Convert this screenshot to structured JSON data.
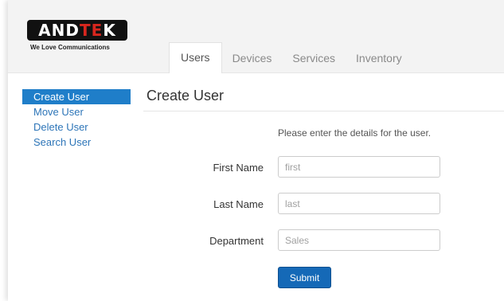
{
  "brand": {
    "name_part1": "AND",
    "name_part2": "TE",
    "name_part3": "K",
    "tagline": "We Love Communications"
  },
  "tabs": [
    {
      "label": "Users",
      "active": true
    },
    {
      "label": "Devices",
      "active": false
    },
    {
      "label": "Services",
      "active": false
    },
    {
      "label": "Inventory",
      "active": false
    }
  ],
  "sidebar": {
    "items": [
      {
        "label": "Create User",
        "active": true
      },
      {
        "label": "Move User",
        "active": false
      },
      {
        "label": "Delete User",
        "active": false
      },
      {
        "label": "Search User",
        "active": false
      }
    ]
  },
  "main": {
    "title": "Create User",
    "intro": "Please enter the details for the user.",
    "form": {
      "first_name": {
        "label": "First Name",
        "placeholder": "first",
        "value": ""
      },
      "last_name": {
        "label": "Last Name",
        "placeholder": "last",
        "value": ""
      },
      "department": {
        "label": "Department",
        "placeholder": "Sales",
        "value": ""
      },
      "submit_label": "Submit"
    }
  },
  "colors": {
    "accent": "#1f7ec9",
    "link": "#2d75b8",
    "button": "#1569b7",
    "logo_red": "#d7261e"
  }
}
